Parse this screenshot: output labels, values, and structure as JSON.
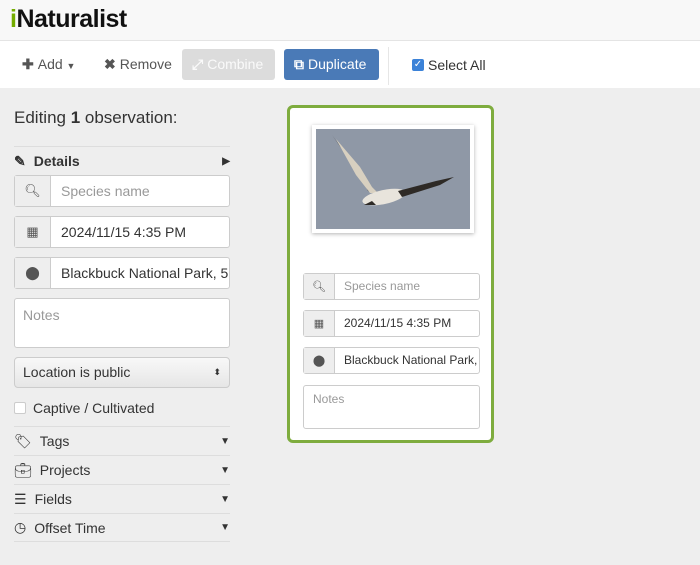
{
  "app": {
    "logo": "iNaturalist"
  },
  "toolbar": {
    "add": "Add",
    "remove": "Remove",
    "combine": "Combine",
    "duplicate": "Duplicate",
    "select_all": "Select All",
    "select_all_checked": true
  },
  "sidebar": {
    "title_pre": "Editing ",
    "count": "1",
    "title_post": " observation:",
    "details": "Details",
    "species_placeholder": "Species name",
    "date": "2024/11/15 4:35 PM",
    "location": "Blackbuck National Park, 5",
    "notes_placeholder": "Notes",
    "geoprivacy": "Location is public",
    "captive": "Captive / Cultivated",
    "sections": [
      "Tags",
      "Projects",
      "Fields",
      "Offset Time"
    ]
  },
  "card": {
    "species_placeholder": "Species name",
    "date": "2024/11/15 4:35 PM",
    "location": "Blackbuck National Park,",
    "notes_placeholder": "Notes"
  },
  "colors": {
    "accent": "#74ac00",
    "selected_border": "#7eac3e",
    "primary": "#4a7ab7"
  }
}
